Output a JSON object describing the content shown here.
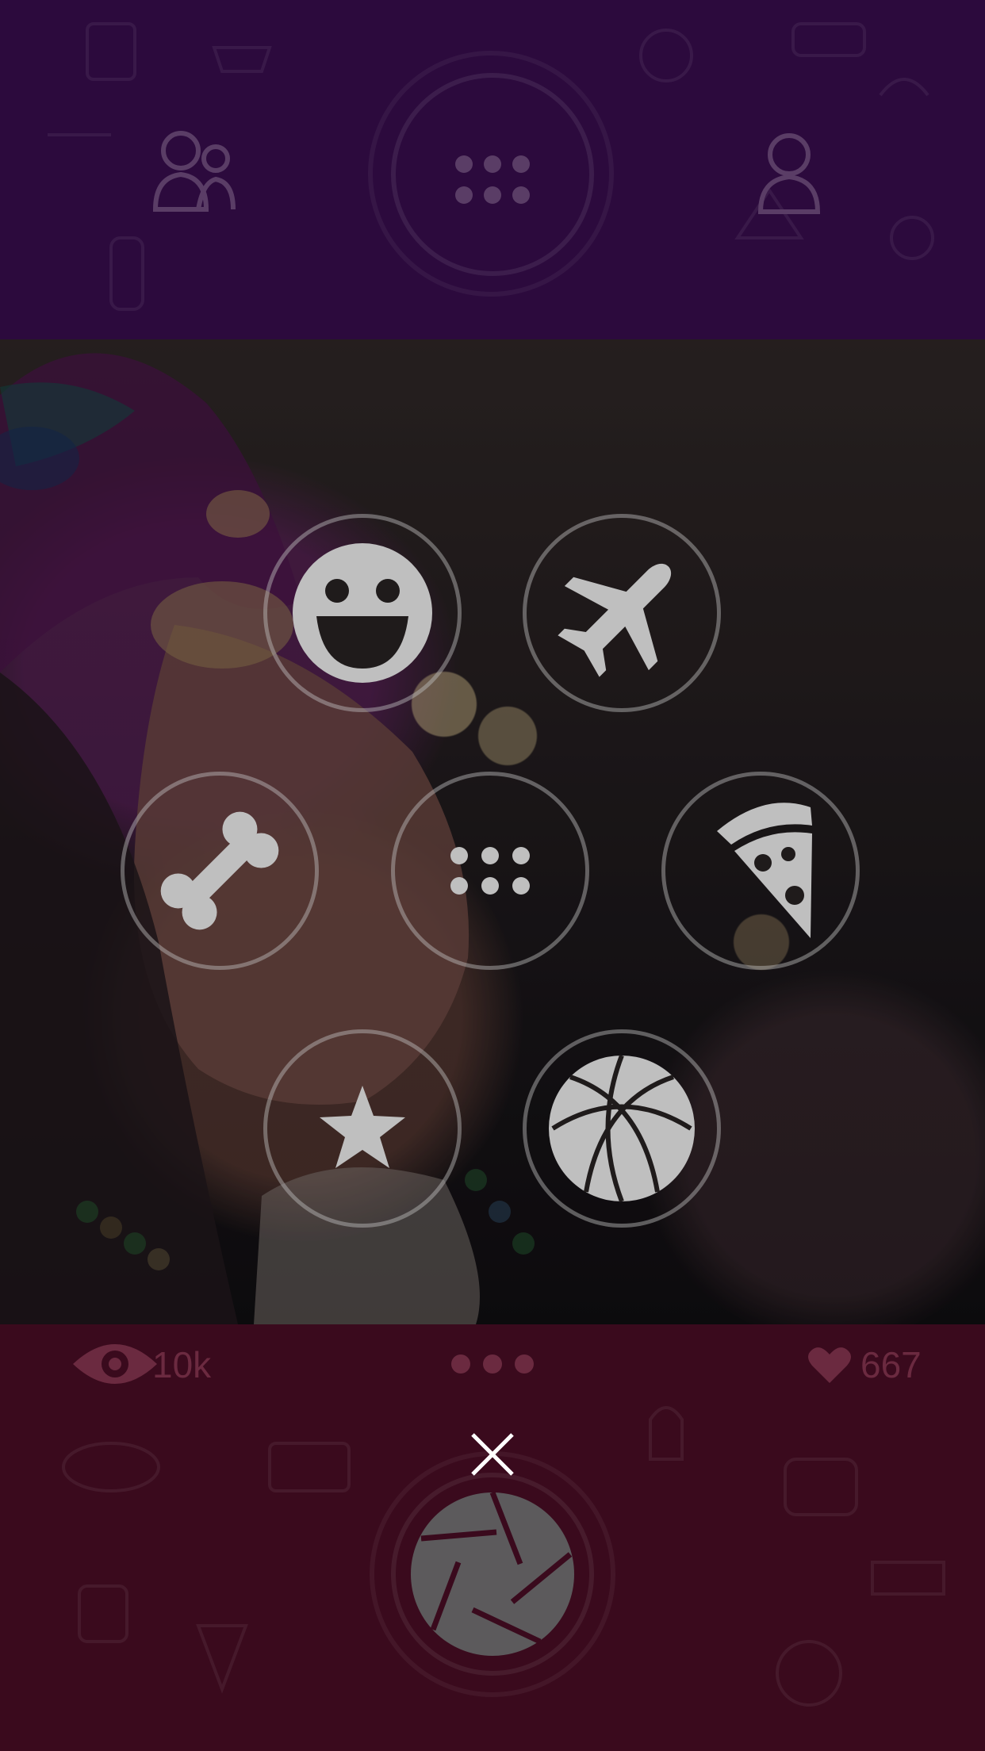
{
  "header": {
    "icons": [
      "friends-icon",
      "menu-dots-icon",
      "profile-icon"
    ]
  },
  "stats": {
    "views": "10k",
    "likes": "667"
  },
  "menu": {
    "categories": [
      {
        "icon": "smiley-icon",
        "selected": true
      },
      {
        "icon": "airplane-icon",
        "selected": false
      },
      {
        "icon": "bone-icon",
        "selected": false
      },
      {
        "icon": "grid-dots-icon",
        "selected": false
      },
      {
        "icon": "pizza-icon",
        "selected": false
      },
      {
        "icon": "star-icon",
        "selected": false
      },
      {
        "icon": "basketball-icon",
        "selected": false
      }
    ]
  },
  "footer": {
    "icons": [
      "close-icon",
      "camera-shutter-icon"
    ]
  },
  "colors": {
    "top_bar": "#2c0a3d",
    "bottom_bar": "#3a0a1d",
    "muted_icon": "#5a3d66",
    "muted_text": "#6b2a40"
  }
}
